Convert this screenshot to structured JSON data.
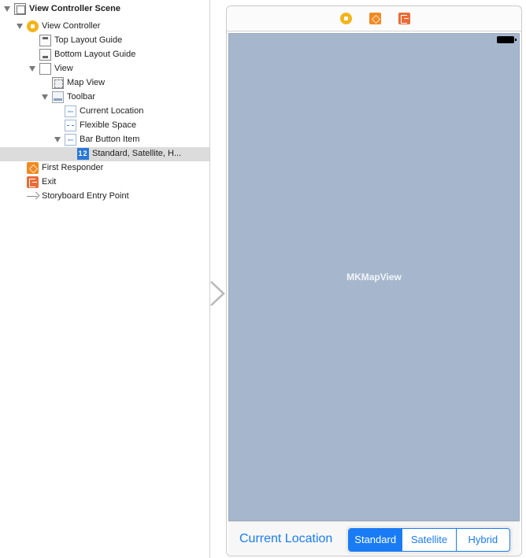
{
  "outline": {
    "items": [
      {
        "label": "View Controller Scene",
        "icon": "scene-icon"
      },
      {
        "label": "View Controller",
        "icon": "view-controller-icon"
      },
      {
        "label": "Top Layout Guide",
        "icon": "top-layout-guide-icon"
      },
      {
        "label": "Bottom Layout Guide",
        "icon": "bottom-layout-guide-icon"
      },
      {
        "label": "View",
        "icon": "view-icon"
      },
      {
        "label": "Map View",
        "icon": "map-view-icon"
      },
      {
        "label": "Toolbar",
        "icon": "toolbar-icon"
      },
      {
        "label": "Current Location",
        "icon": "bar-item-icon"
      },
      {
        "label": "Flexible Space",
        "icon": "flexible-space-icon"
      },
      {
        "label": "Bar Button Item",
        "icon": "bar-item-icon"
      },
      {
        "label": "Standard, Satellite, H...",
        "icon": "segmented-control-icon"
      },
      {
        "label": "First Responder",
        "icon": "first-responder-icon"
      },
      {
        "label": "Exit",
        "icon": "exit-icon"
      },
      {
        "label": "Storyboard Entry Point",
        "icon": "entry-arrow-icon"
      }
    ],
    "selected_index": 10,
    "icon_text": {
      "bar_item": "Item",
      "segmented": "12"
    }
  },
  "scene": {
    "dock_icons": [
      "view-controller-icon",
      "first-responder-icon",
      "exit-icon"
    ],
    "map_label": "MKMapView",
    "toolbar": {
      "current_location": "Current Location",
      "segments": [
        "Standard",
        "Satellite",
        "Hybrid"
      ],
      "selected_segment": "Standard"
    }
  },
  "colors": {
    "accent": "#1a7cf5",
    "map_background": "#a6b7cd",
    "selection": "#dcdcdc",
    "view_controller": "#f3b41b",
    "first_responder": "#f08a24",
    "exit": "#ea6b37"
  }
}
